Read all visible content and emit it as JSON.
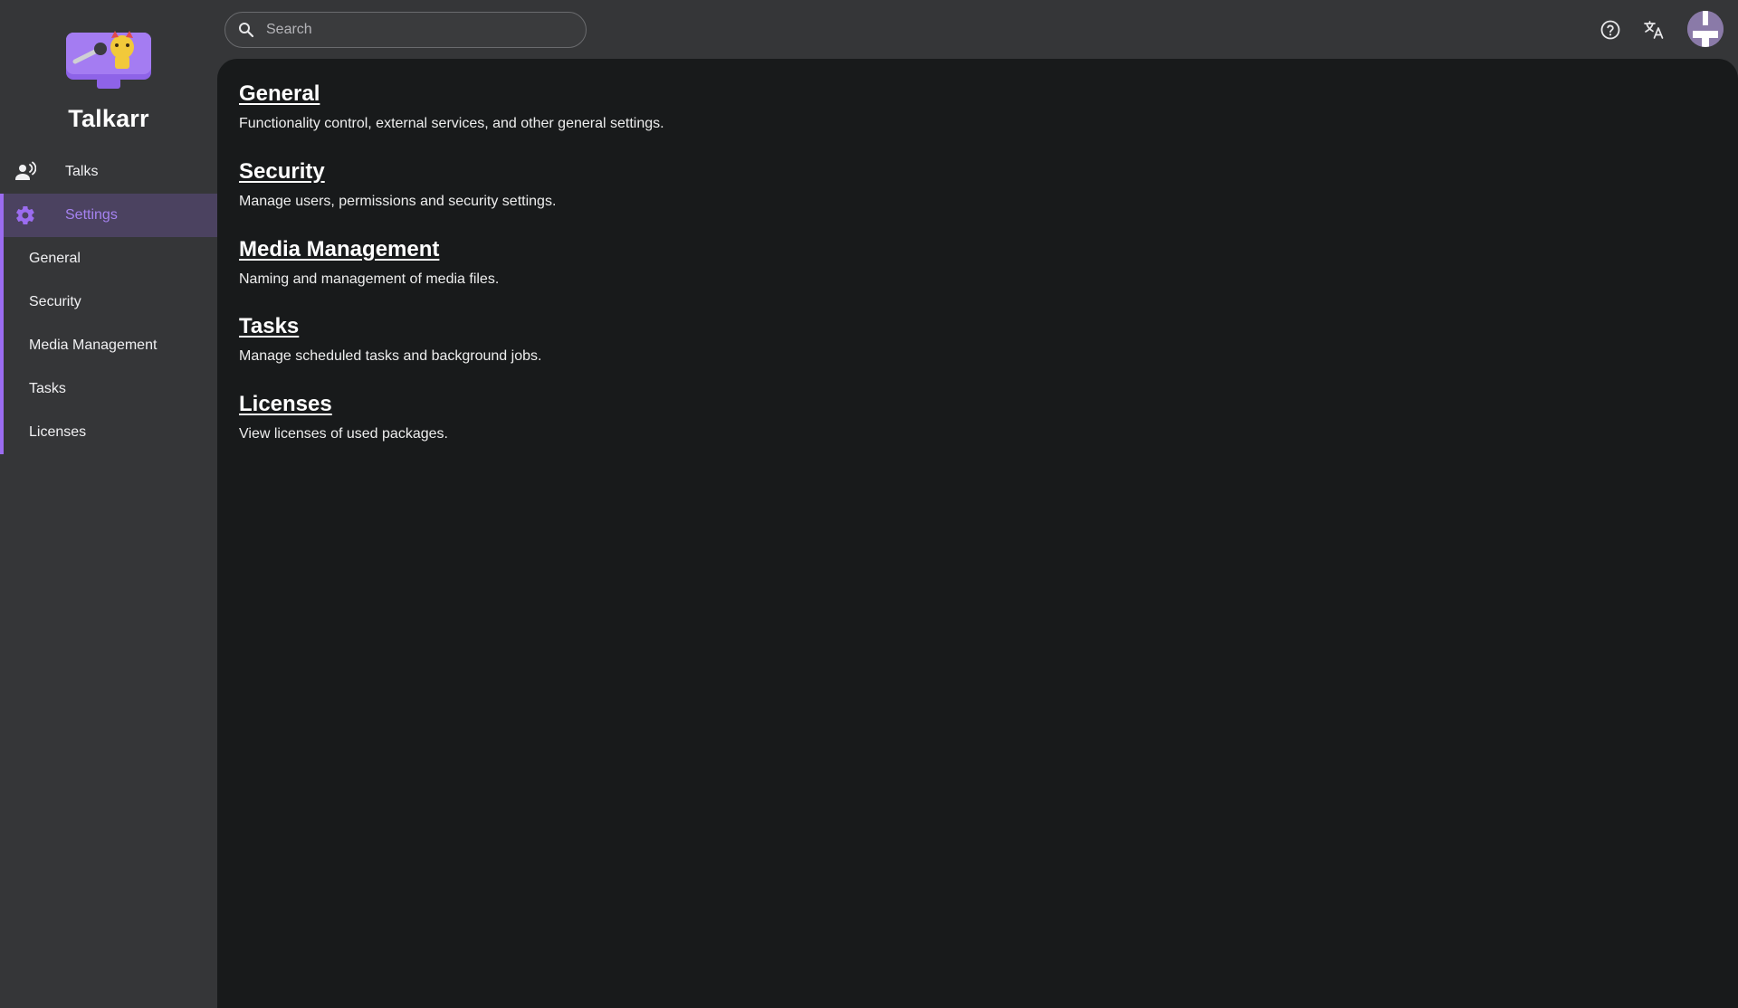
{
  "app": {
    "name": "Talkarr",
    "accent_color": "#9b6cf0"
  },
  "sidebar": {
    "nav": [
      {
        "label": "Talks",
        "icon": "talks-icon"
      },
      {
        "label": "Settings",
        "icon": "gear-icon",
        "active": true
      }
    ],
    "sub_items": [
      {
        "label": "General"
      },
      {
        "label": "Security"
      },
      {
        "label": "Media Management"
      },
      {
        "label": "Tasks"
      },
      {
        "label": "Licenses"
      }
    ]
  },
  "header": {
    "search": {
      "placeholder": "Search",
      "value": ""
    },
    "icons": [
      "help-icon",
      "translate-icon",
      "avatar"
    ]
  },
  "main": {
    "sections": [
      {
        "title": "General",
        "description": "Functionality control, external services, and other general settings."
      },
      {
        "title": "Security",
        "description": "Manage users, permissions and security settings."
      },
      {
        "title": "Media Management",
        "description": "Naming and management of media files."
      },
      {
        "title": "Tasks",
        "description": "Manage scheduled tasks and background jobs."
      },
      {
        "title": "Licenses",
        "description": "View licenses of used packages."
      }
    ]
  }
}
